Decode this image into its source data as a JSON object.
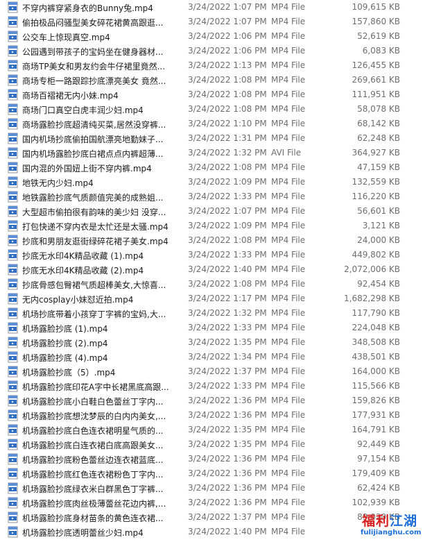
{
  "files": [
    {
      "name": "不穿内裤穿紧身衣的Bunny兔.mp4",
      "date": "3/24/2022 1:07 PM",
      "type": "MP4 File",
      "size": "109,615 KB",
      "icon": "mp4-file-icon"
    },
    {
      "name": "偷拍极品闷骚型美女碎花裙黄高跟逛...",
      "date": "3/24/2022 1:07 PM",
      "type": "MP4 File",
      "size": "157,860 KB",
      "icon": "mp4-file-icon"
    },
    {
      "name": "公交车上惊现真空.mp4",
      "date": "3/24/2022 1:06 PM",
      "type": "MP4 File",
      "size": "52,619 KB",
      "icon": "mp4-file-icon"
    },
    {
      "name": "公园遇到带孩子的宝妈坐在健身器材...",
      "date": "3/24/2022 1:06 PM",
      "type": "MP4 File",
      "size": "6,083 KB",
      "icon": "mp4-file-icon"
    },
    {
      "name": "商场TP美女和男友约会牛仔裙里竟然...",
      "date": "3/24/2022 1:13 PM",
      "type": "MP4 File",
      "size": "126,455 KB",
      "icon": "mp4-file-icon"
    },
    {
      "name": "商场专柜一路跟踪抄底漂亮美女 竟然...",
      "date": "3/24/2022 1:08 PM",
      "type": "MP4 File",
      "size": "269,661 KB",
      "icon": "mp4-file-icon"
    },
    {
      "name": "商场百褶裙无内小妹.mp4",
      "date": "3/24/2022 1:08 PM",
      "type": "MP4 File",
      "size": "111,951 KB",
      "icon": "mp4-file-icon"
    },
    {
      "name": "商场门口真空白虎丰润少妇.mp4",
      "date": "3/24/2022 1:08 PM",
      "type": "MP4 File",
      "size": "58,078 KB",
      "icon": "mp4-file-icon"
    },
    {
      "name": "商场露脸抄底超清纯买菜,居然没穿裤...",
      "date": "3/24/2022 1:10 PM",
      "type": "MP4 File",
      "size": "68,142 KB",
      "icon": "mp4-file-icon"
    },
    {
      "name": "国内机场抄底偷拍国航漂亮地勤妹子...",
      "date": "3/24/2022 1:31 PM",
      "type": "MP4 File",
      "size": "62,248 KB",
      "icon": "mp4-file-icon"
    },
    {
      "name": "国内机场露脸抄底白裙点点内裤超薄...",
      "date": "3/24/2022 1:32 PM",
      "type": "AVI File",
      "size": "364,927 KB",
      "icon": "avi-file-icon"
    },
    {
      "name": "国内混的外国妞上街不穿内裤.mp4",
      "date": "3/24/2022 1:08 PM",
      "type": "MP4 File",
      "size": "47,159 KB",
      "icon": "mp4-file-icon"
    },
    {
      "name": "地铁无内少妇.mp4",
      "date": "3/24/2022 1:09 PM",
      "type": "MP4 File",
      "size": "132,559 KB",
      "icon": "mp4-file-icon"
    },
    {
      "name": "地铁露脸抄底气质颜值完美的成熟姐...",
      "date": "3/24/2022 1:33 PM",
      "type": "MP4 File",
      "size": "116,220 KB",
      "icon": "mp4-file-icon"
    },
    {
      "name": "大型超市偷拍很有韵味的美少妇 没穿...",
      "date": "3/24/2022 1:07 PM",
      "type": "MP4 File",
      "size": "56,601 KB",
      "icon": "mp4-file-icon"
    },
    {
      "name": "打包快递不穿内衣是太忙还是太骚.mp4",
      "date": "3/24/2022 1:09 PM",
      "type": "MP4 File",
      "size": "3,121 KB",
      "icon": "mp4-file-icon"
    },
    {
      "name": "抄底和男朋友逛街绿碎花裙子美女.mp4",
      "date": "3/24/2022 1:08 PM",
      "type": "MP4 File",
      "size": "24,000 KB",
      "icon": "mp4-file-icon"
    },
    {
      "name": "抄底无水印4K精品收藏 (1).mp4",
      "date": "3/24/2022 1:33 PM",
      "type": "MP4 File",
      "size": "449,802 KB",
      "icon": "mp4-file-icon"
    },
    {
      "name": "抄底无水印4K精品收藏 (2).mp4",
      "date": "3/24/2022 1:40 PM",
      "type": "MP4 File",
      "size": "2,072,006 KB",
      "icon": "mp4-file-icon"
    },
    {
      "name": "抄底骨感包臀裙气质超棒美女,大惊喜...",
      "date": "3/24/2022 1:08 PM",
      "type": "MP4 File",
      "size": "92,454 KB",
      "icon": "mp4-file-icon"
    },
    {
      "name": "无内cosplay小妹怼近拍.mp4",
      "date": "3/24/2022 1:17 PM",
      "type": "MP4 File",
      "size": "1,682,298 KB",
      "icon": "mp4-file-icon"
    },
    {
      "name": "机场抄底带着小孩穿丁字裤的宝妈,大...",
      "date": "3/24/2022 1:32 PM",
      "type": "MP4 File",
      "size": "117,790 KB",
      "icon": "mp4-file-icon"
    },
    {
      "name": "机场露脸抄底 (1).mp4",
      "date": "3/24/2022 1:33 PM",
      "type": "MP4 File",
      "size": "224,048 KB",
      "icon": "mp4-file-icon"
    },
    {
      "name": "机场露脸抄底 (2).mp4",
      "date": "3/24/2022 1:35 PM",
      "type": "MP4 File",
      "size": "348,508 KB",
      "icon": "mp4-file-icon"
    },
    {
      "name": "机场露脸抄底 (4).mp4",
      "date": "3/24/2022 1:34 PM",
      "type": "MP4 File",
      "size": "438,501 KB",
      "icon": "mp4-file-icon"
    },
    {
      "name": "机场露脸抄底（5）.mp4",
      "date": "3/24/2022 1:37 PM",
      "type": "MP4 File",
      "size": "164,000 KB",
      "icon": "mp4-file-icon"
    },
    {
      "name": "机场露脸抄底印花A字中长裙黑底高跟...",
      "date": "3/24/2022 1:33 PM",
      "type": "MP4 File",
      "size": "115,566 KB",
      "icon": "mp4-file-icon"
    },
    {
      "name": "机场露脸抄底小白鞋白色蕾丝丁字内...",
      "date": "3/24/2022 1:36 PM",
      "type": "MP4 File",
      "size": "159,826 KB",
      "icon": "mp4-file-icon"
    },
    {
      "name": "机场露脸抄底想沈梦辰的白内内美女,...",
      "date": "3/24/2022 1:36 PM",
      "type": "MP4 File",
      "size": "177,931 KB",
      "icon": "mp4-file-icon"
    },
    {
      "name": "机场露脸抄底白色连衣裙明星气质的...",
      "date": "3/24/2022 1:35 PM",
      "type": "MP4 File",
      "size": "164,791 KB",
      "icon": "mp4-file-icon"
    },
    {
      "name": "机场露脸抄底白连衣裙白底高跟美女...",
      "date": "3/24/2022 1:35 PM",
      "type": "MP4 File",
      "size": "92,449 KB",
      "icon": "mp4-file-icon"
    },
    {
      "name": "机场露脸抄底粉色蕾丝边连衣裙蓝底...",
      "date": "3/24/2022 1:36 PM",
      "type": "MP4 File",
      "size": "97,154 KB",
      "icon": "mp4-file-icon"
    },
    {
      "name": "机场露脸抄底红色连衣裙粉色丁字内...",
      "date": "3/24/2022 1:36 PM",
      "type": "MP4 File",
      "size": "179,409 KB",
      "icon": "mp4-file-icon"
    },
    {
      "name": "机场露脸抄底绿衣米白群黑色丁字裤...",
      "date": "3/24/2022 1:36 PM",
      "type": "MP4 File",
      "size": "62,424 KB",
      "icon": "mp4-file-icon"
    },
    {
      "name": "机场露脸抄底肉丝极薄蕾丝花边内裤,...",
      "date": "3/24/2022 1:36 PM",
      "type": "MP4 File",
      "size": "102,939 KB",
      "icon": "mp4-file-icon"
    },
    {
      "name": "机场露脸抄底身材苗条的黄色连衣裙...",
      "date": "3/24/2022 1:37 PM",
      "type": "MP4 File",
      "size": "89,020 KB",
      "icon": "mp4-file-icon"
    },
    {
      "name": "机场露脸抄底透明蕾丝少妇.mp4",
      "date": "3/24/2022 1:40 PM",
      "type": "MP4 File",
      "size": "",
      "icon": "mp4-file-icon"
    }
  ],
  "watermark": {
    "text_part1": "福利",
    "text_part2": "江湖",
    "url": "fulijianghu.com",
    "color_red": "#d81e1e",
    "color_blue": "#1e6fd8"
  }
}
